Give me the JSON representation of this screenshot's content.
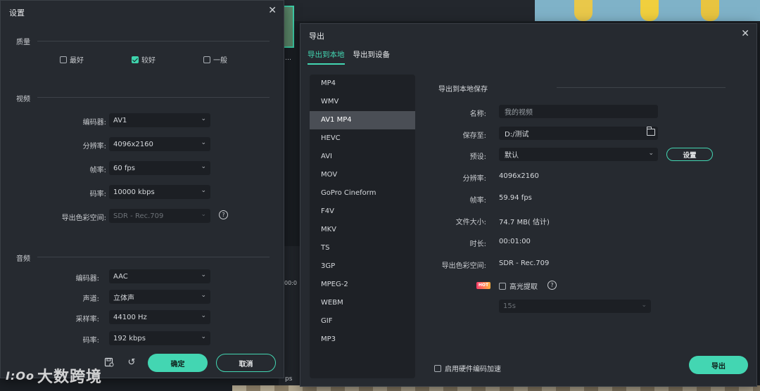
{
  "background": {
    "timeline_snippet_1": "…",
    "timeline_snippet_2": "00:0",
    "timeline_snippet_3": "ps"
  },
  "settings": {
    "title": "设置",
    "quality": {
      "label": "质量",
      "options": [
        {
          "label": "最好",
          "checked": false
        },
        {
          "label": "较好",
          "checked": true
        },
        {
          "label": "一般",
          "checked": false
        }
      ]
    },
    "video": {
      "label": "视频",
      "encoder_label": "编码器:",
      "encoder": "AV1",
      "resolution_label": "分辨率:",
      "resolution": "4096x2160",
      "framerate_label": "帧率:",
      "framerate": "60 fps",
      "bitrate_label": "码率:",
      "bitrate": "10000 kbps",
      "colorspace_label": "导出色彩空间:",
      "colorspace": "SDR - Rec.709"
    },
    "audio": {
      "label": "音频",
      "encoder_label": "编码器:",
      "encoder": "AAC",
      "channel_label": "声道:",
      "channel": "立体声",
      "samplerate_label": "采样率:",
      "samplerate": "44100 Hz",
      "bitrate_label": "码率:",
      "bitrate": "192 kbps"
    },
    "ok_label": "确定",
    "cancel_label": "取消"
  },
  "watermark": {
    "logo": "I:Oo",
    "text": "大数跨境"
  },
  "export": {
    "title": "导出",
    "tabs": [
      {
        "label": "导出到本地",
        "active": true
      },
      {
        "label": "导出到设备",
        "active": false
      }
    ],
    "formats": [
      "MP4",
      "WMV",
      "AV1 MP4",
      "HEVC",
      "AVI",
      "MOV",
      "GoPro Cineform",
      "F4V",
      "MKV",
      "TS",
      "3GP",
      "MPEG-2",
      "WEBM",
      "GIF",
      "MP3"
    ],
    "selected_format": "AV1 MP4",
    "section_title": "导出到本地保存",
    "name_label": "名称:",
    "name_placeholder": "我的视频",
    "save_label": "保存至:",
    "save_path": "D:/测试",
    "preset_label": "预设:",
    "preset": "默认",
    "settings_button": "设置",
    "resolution_label": "分辨率:",
    "resolution": "4096x2160",
    "framerate_label": "帧率:",
    "framerate": "59.94 fps",
    "filesize_label": "文件大小:",
    "filesize": "74.7 MB( 估计)",
    "duration_label": "时长:",
    "duration": "00:01:00",
    "colorspace_label": "导出色彩空间:",
    "colorspace": "SDR - Rec.709",
    "hot_badge": "HOT",
    "highlight_label": "高光提取",
    "highlight_duration": "15s",
    "hw_accel_label": "启用硬件编码加速",
    "export_button": "导出"
  }
}
